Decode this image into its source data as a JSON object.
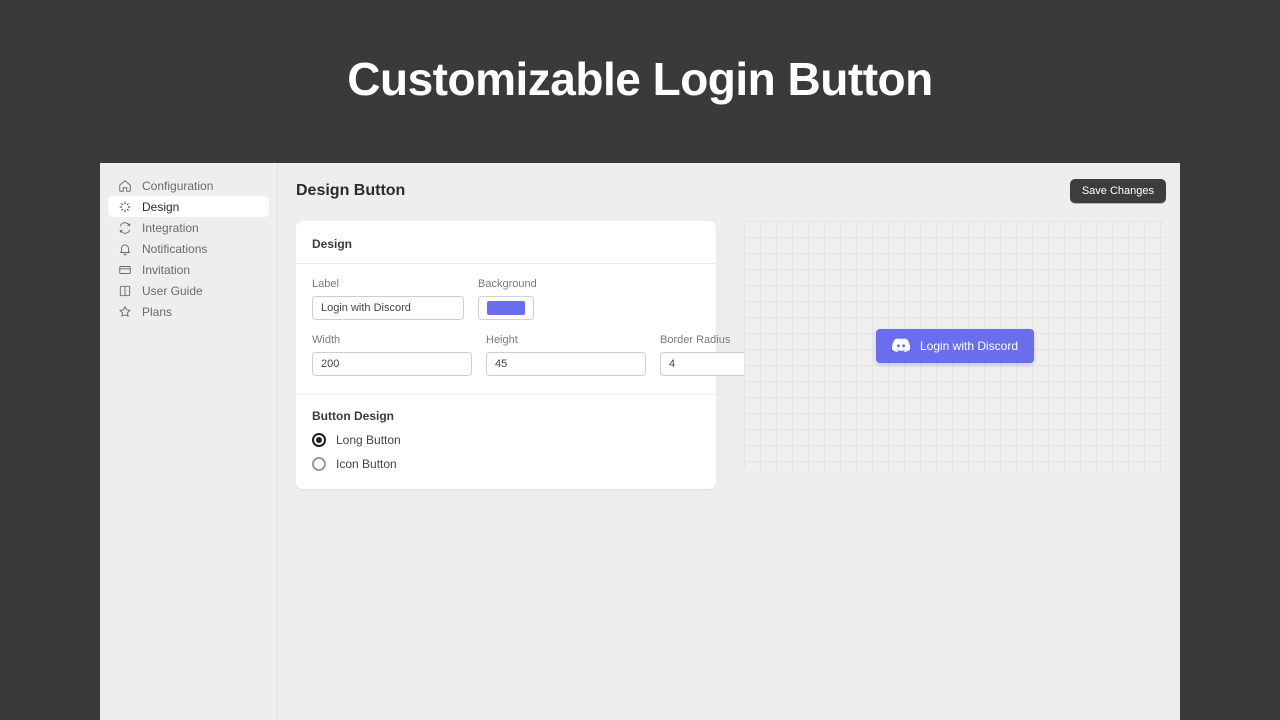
{
  "hero_title": "Customizable Login Button",
  "sidebar": {
    "items": [
      {
        "label": "Configuration"
      },
      {
        "label": "Design"
      },
      {
        "label": "Integration"
      },
      {
        "label": "Notifications"
      },
      {
        "label": "Invitation"
      },
      {
        "label": "User Guide"
      },
      {
        "label": "Plans"
      }
    ],
    "active_index": 1
  },
  "header": {
    "title": "Design Button",
    "save_label": "Save Changes"
  },
  "design_card": {
    "section_title": "Design",
    "fields": {
      "label": {
        "label": "Label",
        "value": "Login with Discord"
      },
      "bg": {
        "label": "Background",
        "value": "#6a6eec"
      },
      "width": {
        "label": "Width",
        "value": "200"
      },
      "height": {
        "label": "Height",
        "value": "45"
      },
      "radius": {
        "label": "Border Radius",
        "value": "4"
      }
    },
    "button_design": {
      "section_title": "Button Design",
      "options": {
        "long": "Long Button",
        "icon": "Icon Button"
      },
      "selected": "long"
    }
  },
  "preview": {
    "button_label": "Login with Discord",
    "button_bg": "#6a6eec"
  }
}
